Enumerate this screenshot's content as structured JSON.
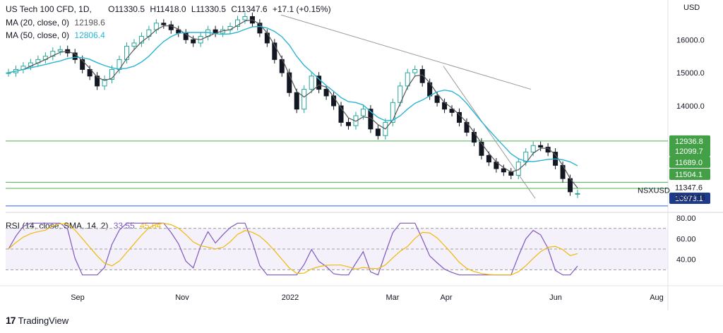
{
  "header": {
    "symbol": "US Tech 100 CFD, 1D,",
    "ohlc": {
      "o": "O11330.5",
      "h": "H11418.0",
      "l": "L11330.5",
      "c": "C11347.6",
      "chg": "+17.1 (+0.15%)"
    },
    "ma20_label": "MA (20, close, 0)",
    "ma20_value": "12198.6",
    "ma50_label": "MA (50, close, 0)",
    "ma50_value": "12806.4",
    "rsi_label": "RSI (14, close, SMA, 14, 2)",
    "rsi_value": "33.55",
    "rsi_ma_value": "45.64"
  },
  "currency": "USD",
  "colors": {
    "up": "#26a69a",
    "down": "#131722",
    "ma20": "#555555",
    "ma50": "#2ab5d4",
    "hline": "#4caf50",
    "support": "#2962ff",
    "rsi": "#7e57c2",
    "rsi_ma": "#f0b90b",
    "badge": "#43a047",
    "blue_badge": "#1e3a8a"
  },
  "chart_data": [
    {
      "type": "candlestick",
      "title": "US Tech 100 CFD, 1D",
      "ylabel": "USD",
      "ylim": [
        11000,
        17000
      ],
      "yticks": [
        14000,
        15000,
        16000
      ],
      "x_ticks": [
        "Sep",
        "Nov",
        "2022",
        "Mar",
        "Apr",
        "Jun",
        "Aug"
      ],
      "close_path": [
        15000,
        15100,
        15200,
        15300,
        15400,
        15500,
        15650,
        15700,
        15600,
        15400,
        15100,
        14900,
        14600,
        14800,
        15100,
        15400,
        15800,
        15900,
        16100,
        16300,
        16500,
        16450,
        16300,
        16200,
        16000,
        15900,
        16100,
        16300,
        16200,
        16300,
        16400,
        16600,
        16700,
        16500,
        16200,
        15900,
        15400,
        15000,
        14400,
        13900,
        14500,
        14900,
        14500,
        14300,
        14000,
        13500,
        13400,
        13700,
        13900,
        13300,
        13100,
        13500,
        14100,
        14600,
        15000,
        15100,
        14700,
        14300,
        14100,
        13900,
        13800,
        13500,
        13200,
        12900,
        12500,
        12300,
        12100,
        12000,
        11900,
        12300,
        12600,
        12800,
        12750,
        12600,
        12200,
        11800,
        11400,
        11347.6
      ],
      "ohlc_last": {
        "open": 11330.5,
        "high": 11418.0,
        "low": 11330.5,
        "close": 11347.6
      },
      "ma20_last": 12198.6,
      "ma50_last": 12806.4,
      "price_labels": [
        "12936.8",
        "12099.7",
        "11689.0",
        "11504.1",
        "11347.6",
        "10973.1"
      ],
      "hlines": [
        12936.8,
        11689.0,
        11504.1,
        10973.1
      ],
      "countdown": "16:02:36",
      "symbol_tag": "NSXUSD"
    },
    {
      "type": "line",
      "title": "RSI (14, close, SMA, 14, 2)",
      "ylim": [
        20,
        80
      ],
      "yticks": [
        "40.00",
        "60.00",
        "80.00"
      ],
      "rsi_last": 33.55,
      "rsi_ma_last": 45.64
    }
  ],
  "footer": {
    "brand": "TradingView"
  }
}
